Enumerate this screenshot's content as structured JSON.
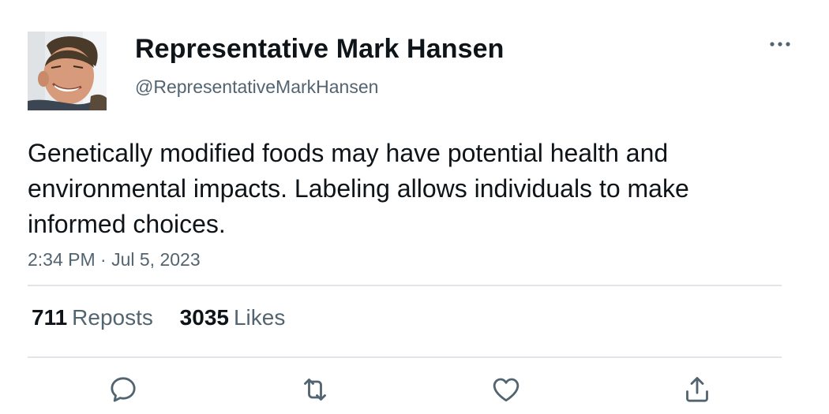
{
  "author": {
    "display_name": "Representative Mark Hansen",
    "handle": "@RepresentativeMarkHansen",
    "avatar_icon": "profile-photo"
  },
  "menu": {
    "icon": "more-horizontal-icon",
    "label": "···"
  },
  "tweet": {
    "text": "Genetically modified foods may have potential health and environmental impacts. Labeling allows individuals to make informed choices.",
    "timestamp": "2:34 PM · Jul 5, 2023"
  },
  "stats": {
    "reposts_count": "711",
    "reposts_label": "Reposts",
    "likes_count": "3035",
    "likes_label": "Likes"
  },
  "actions": [
    {
      "name": "reply",
      "icon": "reply-bubble-icon"
    },
    {
      "name": "repost",
      "icon": "repost-arrows-icon"
    },
    {
      "name": "like",
      "icon": "heart-icon"
    },
    {
      "name": "share",
      "icon": "share-upload-icon"
    }
  ],
  "colors": {
    "text_primary": "#0f1419",
    "text_secondary": "#536471",
    "divider": "#e1e4e8",
    "icon": "#536471"
  }
}
